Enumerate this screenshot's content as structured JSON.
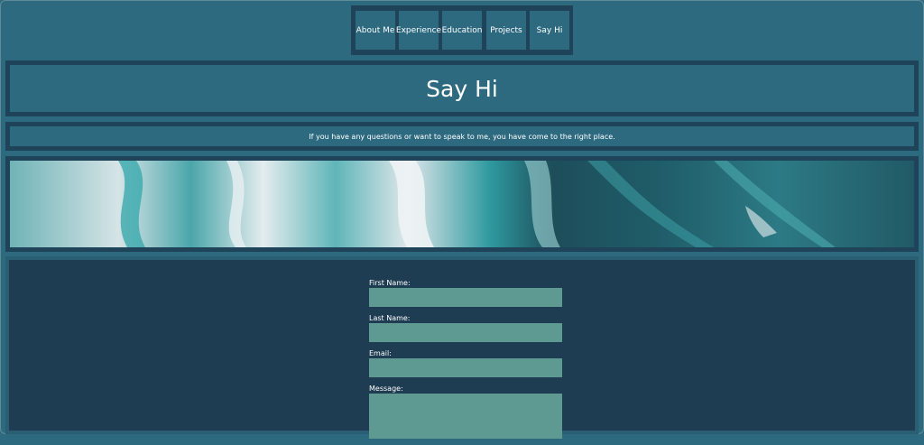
{
  "nav": {
    "items": [
      {
        "label": "About Me"
      },
      {
        "label": "Experience"
      },
      {
        "label": "Education"
      },
      {
        "label": "Projects"
      },
      {
        "label": "Say Hi"
      }
    ]
  },
  "header": {
    "title": "Say Hi",
    "intro": "If you have any questions or want to speak to me, you have come to the right place."
  },
  "form": {
    "first_name_label": "First Name:",
    "last_name_label": "Last Name:",
    "email_label": "Email:",
    "message_label": "Message:"
  },
  "colors": {
    "page_bg": "#2d6a80",
    "border": "#1f445a",
    "form_bg": "#1e3d52",
    "field_bg": "#5f9a92"
  }
}
